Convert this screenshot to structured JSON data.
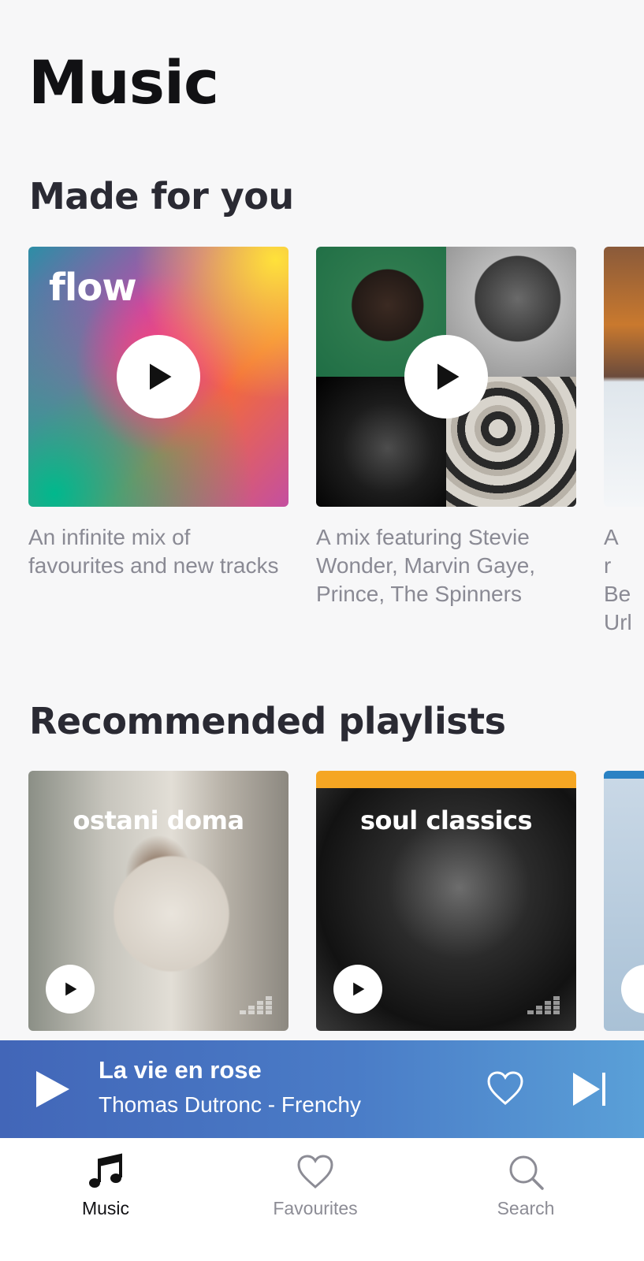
{
  "header": {
    "title": "Music"
  },
  "made_for_you": {
    "title": "Made for you",
    "cards": [
      {
        "art_text": "flow",
        "description": "An infinite mix of favourites and new tracks"
      },
      {
        "art_text": "",
        "description": "A mix featuring Stevie Wonder, Marvin Gaye, Prince, The Spinners"
      },
      {
        "art_text": "",
        "description": "A r Be Url"
      }
    ]
  },
  "recommended": {
    "title": "Recommended playlists",
    "cards": [
      {
        "label": "ostani doma"
      },
      {
        "label": "soul classics"
      },
      {
        "label": ""
      }
    ]
  },
  "player": {
    "track": "La vie en rose",
    "subtitle": "Thomas Dutronc - Frenchy",
    "accent_start": "#4266b8",
    "accent_end": "#5aa0d8"
  },
  "nav": {
    "items": [
      {
        "label": "Music",
        "icon": "music-note-icon",
        "active": true
      },
      {
        "label": "Favourites",
        "icon": "heart-icon",
        "active": false
      },
      {
        "label": "Search",
        "icon": "search-icon",
        "active": false
      }
    ]
  }
}
